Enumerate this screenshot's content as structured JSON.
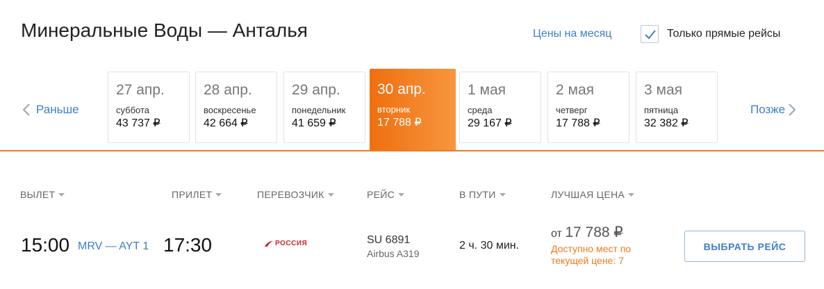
{
  "header": {
    "title": "Минеральные Воды — Анталья",
    "month_link": "Цены на месяц",
    "direct_only_label": "Только прямые рейсы",
    "direct_only_checked": true
  },
  "nav": {
    "prev_label": "Раньше",
    "next_label": "Позже"
  },
  "days": [
    {
      "date": "27 апр.",
      "weekday": "суббота",
      "price": "43 737",
      "currency": "₽"
    },
    {
      "date": "28 апр.",
      "weekday": "воскресенье",
      "price": "42 664",
      "currency": "₽"
    },
    {
      "date": "29 апр.",
      "weekday": "понедельник",
      "price": "41 659",
      "currency": "₽"
    },
    {
      "date": "30 апр.",
      "weekday": "вторник",
      "price": "17 788",
      "currency": "₽",
      "selected": true
    },
    {
      "date": "1 мая",
      "weekday": "среда",
      "price": "29 167",
      "currency": "₽"
    },
    {
      "date": "2 мая",
      "weekday": "четверг",
      "price": "17 788",
      "currency": "₽"
    },
    {
      "date": "3 мая",
      "weekday": "пятница",
      "price": "32 382",
      "currency": "₽"
    }
  ],
  "columns": {
    "departure": "ВЫЛЕТ",
    "arrival": "ПРИЛЕТ",
    "carrier": "ПЕРЕВОЗЧИК",
    "flight": "РЕЙС",
    "duration": "В ПУТИ",
    "best_price": "ЛУЧШАЯ ЦЕНА"
  },
  "flight": {
    "departure_time": "15:00",
    "route": "MRV — AYT 1",
    "arrival_time": "17:30",
    "carrier_name": "РОССИЯ",
    "flight_number": "SU 6891",
    "aircraft": "Airbus A319",
    "duration": "2 ч. 30 мин.",
    "price_prefix": "от",
    "price": "17 788",
    "currency": "₽",
    "availability": "Доступно мест по текущей цене: 7",
    "select_label": "ВЫБРАТЬ РЕЙС"
  },
  "colors": {
    "accent_orange": "#ef7a1d",
    "link_blue": "#3d7ec7",
    "carrier_red": "#c9252c"
  }
}
